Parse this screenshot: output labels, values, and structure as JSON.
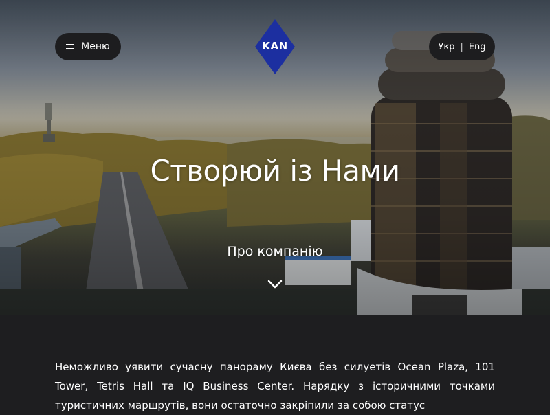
{
  "header": {
    "menu_label": "Меню",
    "logo_text": "KAN",
    "lang": {
      "ukr": "Укр",
      "separator": "|",
      "eng": "Eng"
    }
  },
  "hero": {
    "headline": "Створюй із Нами",
    "about_link": "Про компанію"
  },
  "content": {
    "paragraph": "Неможливо уявити сучасну панораму Києва без силуетів Ocean Plaza, 101 Tower, Tetris Hall та IQ Business Center. Нарядку з історичними точками туристичних маршрутів, вони остаточно закріпили за собою статус"
  },
  "colors": {
    "page_bg": "#1e1e20",
    "pill_bg": "#1d1d1f",
    "logo_blue": "#1c2fa0",
    "text": "#ffffff"
  },
  "icons": {
    "menu": "hamburger-icon",
    "scroll": "chevron-down-icon"
  }
}
